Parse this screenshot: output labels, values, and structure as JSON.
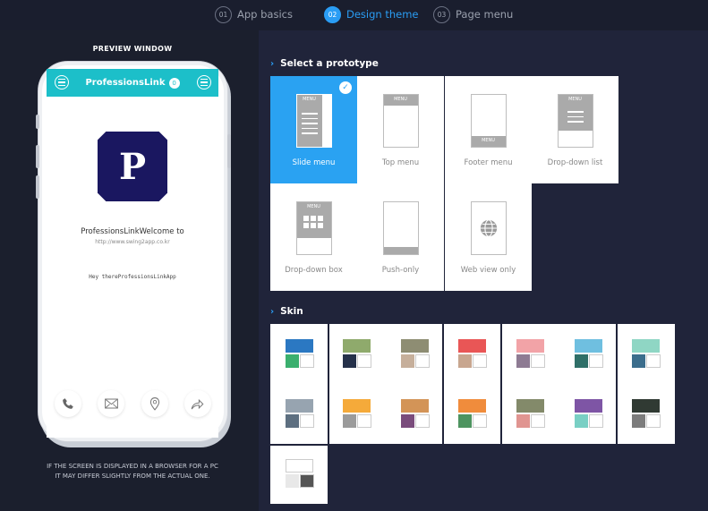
{
  "steps": [
    {
      "num": "01",
      "label": "App basics"
    },
    {
      "num": "02",
      "label": "Design theme"
    },
    {
      "num": "03",
      "label": "Page menu"
    }
  ],
  "preview": {
    "title": "PREVIEW WINDOW",
    "app_title": "ProfessionsLink",
    "badge": "0",
    "logo_letter": "P",
    "welcome": "ProfessionsLinkWelcome to",
    "url": "http://www.swing2app.co.kr",
    "greeting": "Hey thereProfessionsLinkApp",
    "note_line1": "IF THE SCREEN IS DISPLAYED IN A BROWSER FOR A PC",
    "note_line2": "IT MAY DIFFER SLIGHTLY FROM THE ACTUAL ONE.",
    "bottom_icons": [
      "phone-icon",
      "mail-icon",
      "location-icon",
      "share-icon"
    ]
  },
  "prototype_section": {
    "title": "Select a prototype",
    "chevron": "›",
    "items": [
      {
        "label": "Slide menu",
        "menu": "MENU",
        "selected": true
      },
      {
        "label": "Top menu",
        "menu": "MENU"
      },
      {
        "label": "Footer menu",
        "menu": "MENU"
      },
      {
        "label": "Drop-down list",
        "menu": "MENU"
      },
      {
        "label": "Drop-down box",
        "menu": "MENU"
      },
      {
        "label": "Push-only"
      },
      {
        "label": "Web view only"
      }
    ]
  },
  "skin_section": {
    "title": "Skin",
    "chevron": "›"
  },
  "skins": [
    {
      "top": "#2b78c2",
      "bl": "#3aaf6e",
      "br": "#ffffff"
    },
    {
      "top": "#8faa6c",
      "bl": "#25314a",
      "br": "#ffffff"
    },
    {
      "top": "#8e8d73",
      "bl": "#c6af9b",
      "br": "#ffffff"
    },
    {
      "top": "#e95656",
      "bl": "#c8a68f",
      "br": "#ffffff"
    },
    {
      "top": "#f2a3a7",
      "bl": "#8e7b93",
      "br": "#ffffff"
    },
    {
      "top": "#6fbfe0",
      "bl": "#2f6f68",
      "br": "#ffffff"
    },
    {
      "top": "#8fd6c4",
      "bl": "#3b6d8c",
      "br": "#ffffff"
    },
    {
      "top": "#97a4b0",
      "bl": "#5d6f80",
      "br": "#ffffff"
    },
    {
      "top": "#f5aa3a",
      "bl": "#9b9b9b",
      "br": "#ffffff"
    },
    {
      "top": "#d39457",
      "bl": "#7a4c7c",
      "br": "#ffffff"
    },
    {
      "top": "#f08c3c",
      "bl": "#4e9460",
      "br": "#ffffff"
    },
    {
      "top": "#838a6a",
      "bl": "#e09591",
      "br": "#ffffff"
    },
    {
      "top": "#7e55a5",
      "bl": "#79cfc4",
      "br": "#ffffff"
    },
    {
      "top": "#303a33",
      "bl": "#7c7c7c",
      "br": "#ffffff"
    },
    {
      "top": "#ffffff",
      "bl": "#e8e8e8",
      "br": "#555555"
    }
  ],
  "colors": {
    "accent": "#2a9df4",
    "app_bar": "#1cbfc9",
    "logo_bg": "#1a1760"
  }
}
